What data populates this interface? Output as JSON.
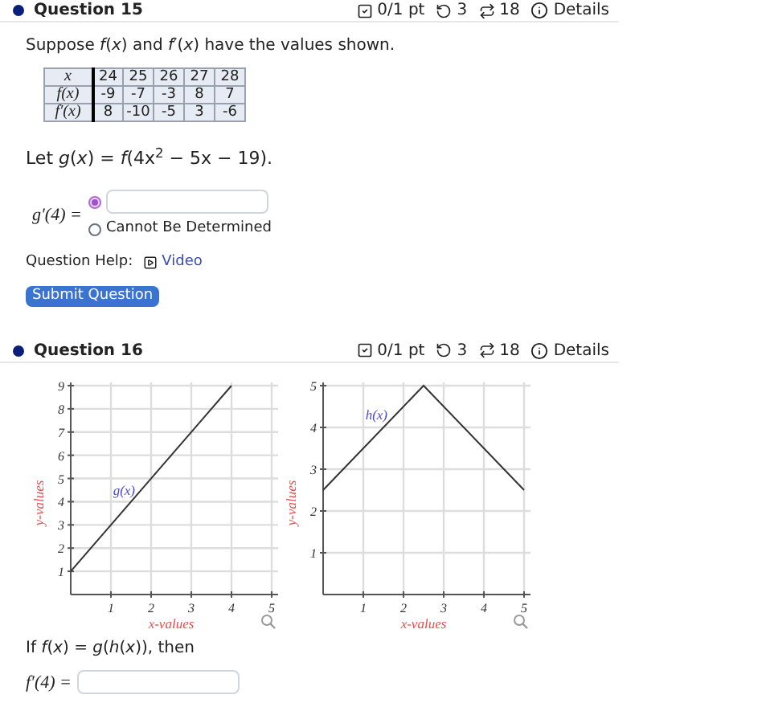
{
  "question_15": {
    "header": {
      "title": "Question 15",
      "score": "0/1 pt",
      "retries": "3",
      "attempts": "18",
      "details": "Details"
    },
    "intro": "Suppose *f*(*x*) and *f*′(*x*) have the values shown.",
    "table": {
      "rows": [
        [
          "x",
          "24",
          "25",
          "26",
          "27",
          "28"
        ],
        [
          "f(x)",
          "-9",
          "-7",
          "-3",
          "8",
          "7"
        ],
        [
          "f′(x)",
          "8",
          "-10",
          "-5",
          "3",
          "-6"
        ]
      ]
    },
    "definition": "Let *g*(*x*) = *f*(4x$^{2}$ − 5x − 19).",
    "answer": {
      "label": "g′(4) =",
      "options": [
        {
          "kind": "input",
          "selected": true
        },
        {
          "kind": "radio",
          "label": "Cannot Be Determined",
          "selected": false
        }
      ]
    },
    "help": {
      "label": "Question Help:",
      "link": "Video"
    },
    "submit": "Submit Question"
  },
  "question_16": {
    "header": {
      "title": "Question 16",
      "score": "0/1 pt",
      "retries": "3",
      "attempts": "18",
      "details": "Details"
    },
    "charts": [
      {
        "chart_data": {
          "type": "line",
          "xlabel": "x-values",
          "ylabel": "y-values",
          "x": [
            0,
            4
          ],
          "xlim": [
            0,
            5
          ],
          "ylim": [
            0,
            9
          ],
          "grid": true,
          "xticks": [
            {
              "value": 1,
              "label": "1"
            },
            {
              "value": 2,
              "label": "2"
            },
            {
              "value": 3,
              "label": "3"
            },
            {
              "value": 4,
              "label": "4"
            },
            {
              "value": 5,
              "label": "5"
            }
          ],
          "yticks": [
            {
              "value": 1,
              "label": "1"
            },
            {
              "value": 2,
              "label": "2"
            },
            {
              "value": 3,
              "label": "3"
            },
            {
              "value": 4,
              "label": "4"
            },
            {
              "value": 5,
              "label": "5"
            },
            {
              "value": 6,
              "label": "6"
            },
            {
              "value": 7,
              "label": "7"
            },
            {
              "value": 8,
              "label": "8"
            },
            {
              "value": 9,
              "label": "9"
            }
          ],
          "series": [
            {
              "color": "#333333",
              "values": [
                1,
                9
              ]
            }
          ],
          "annotations": [
            {
              "text": "g(x)",
              "x": 1.6,
              "y": 4.3
            }
          ]
        }
      },
      {
        "chart_data": {
          "type": "line",
          "xlabel": "x-values",
          "ylabel": "y-values",
          "x": [
            0,
            2.5,
            5
          ],
          "xlim": [
            0,
            5
          ],
          "ylim": [
            0,
            5
          ],
          "grid": true,
          "xticks": [
            {
              "value": 1,
              "label": "1"
            },
            {
              "value": 2,
              "label": "2"
            },
            {
              "value": 3,
              "label": "3"
            },
            {
              "value": 4,
              "label": "4"
            },
            {
              "value": 5,
              "label": "5"
            }
          ],
          "yticks": [
            {
              "value": 1,
              "label": "1"
            },
            {
              "value": 2,
              "label": "2"
            },
            {
              "value": 3,
              "label": "3"
            },
            {
              "value": 4,
              "label": "4"
            },
            {
              "value": 5,
              "label": "5"
            }
          ],
          "series": [
            {
              "color": "#333333",
              "values": [
                2.5,
                5,
                2.5
              ]
            }
          ],
          "annotations": [
            {
              "text": "h(x)",
              "x": 1.6,
              "y": 4.2
            }
          ]
        }
      }
    ],
    "prompt": "If *f*(*x*) = *g*(*h*(*x*)), then",
    "answer": {
      "label": "f′(4) ="
    }
  }
}
